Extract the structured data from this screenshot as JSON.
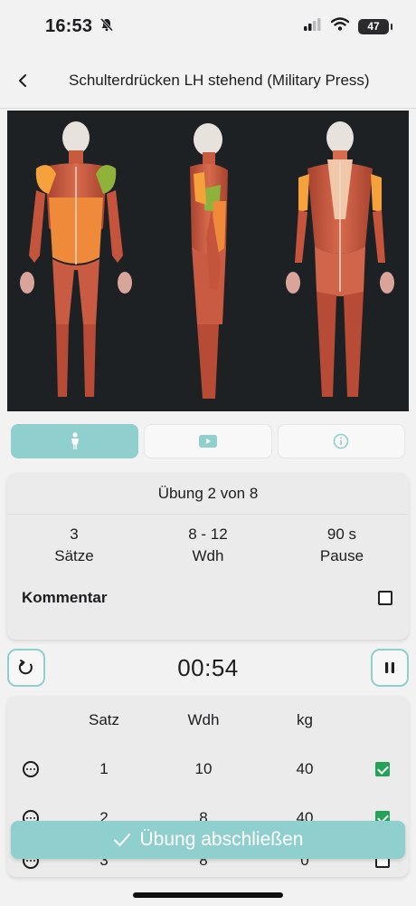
{
  "status_bar": {
    "time": "16:53",
    "battery": "47",
    "icons": [
      "bell-muted-icon",
      "cellular-icon",
      "wifi-icon",
      "battery-icon"
    ]
  },
  "header": {
    "back_icon": "chevron-left-icon",
    "title": "Schulterdrücken LH stehend (Military Press)"
  },
  "tabs": [
    {
      "icon": "person-icon",
      "active": true
    },
    {
      "icon": "play-video-icon",
      "active": false
    },
    {
      "icon": "info-icon",
      "active": false
    }
  ],
  "info": {
    "exercise_count": "Übung 2 von 8",
    "stats": [
      {
        "value": "3",
        "label": "Sätze"
      },
      {
        "value": "8 - 12",
        "label": "Wdh"
      },
      {
        "value": "90 s",
        "label": "Pause"
      }
    ],
    "comment_label": "Kommentar",
    "comment_checked": false
  },
  "timer": {
    "value": "00:54",
    "reset_icon": "reset-icon",
    "pause_icon": "pause-icon"
  },
  "sets": {
    "headers": {
      "set": "Satz",
      "reps": "Wdh",
      "weight": "kg"
    },
    "rows": [
      {
        "set": "1",
        "reps": "10",
        "weight": "40",
        "done": true
      },
      {
        "set": "2",
        "reps": "8",
        "weight": "40",
        "done": true
      },
      {
        "set": "3",
        "reps": "8",
        "weight": "0",
        "done": false
      }
    ]
  },
  "finish_button": {
    "label": "Übung abschließen",
    "icon": "checkmark-icon"
  },
  "colors": {
    "accent": "#8fcfcd",
    "check_green": "#22a356",
    "image_bg": "#1d2124",
    "highlight_orange": "#f5a23c",
    "highlight_green": "#8fb33a"
  }
}
